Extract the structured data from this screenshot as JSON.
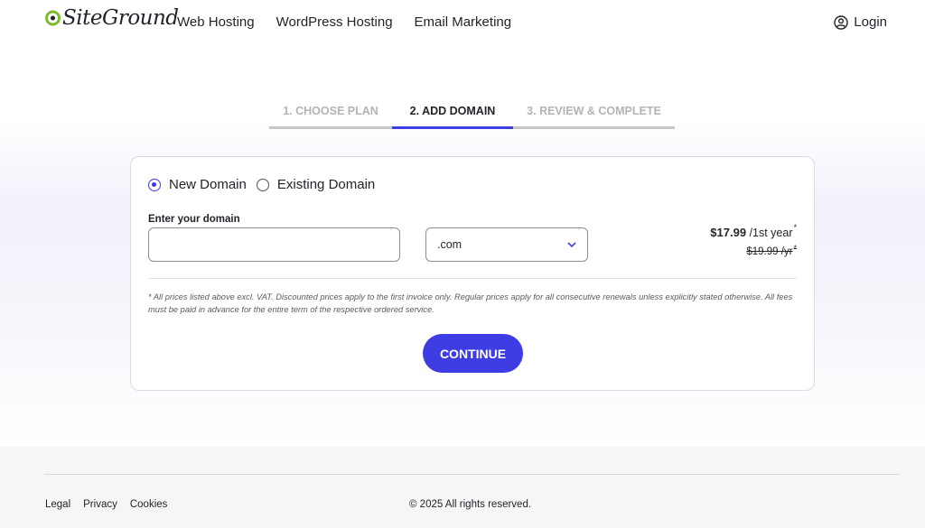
{
  "header": {
    "logo_text": "SiteGround",
    "nav": [
      "Web Hosting",
      "WordPress Hosting",
      "Email Marketing"
    ],
    "login_label": "Login"
  },
  "steps": [
    "1. CHOOSE PLAN",
    "2. ADD DOMAIN",
    "3. REVIEW & COMPLETE"
  ],
  "form": {
    "radio_new": "New Domain",
    "radio_existing": "Existing Domain",
    "selected_option": "New Domain",
    "domain_label": "Enter your domain",
    "domain_value": "",
    "tld_selected": ".com",
    "price_now": "$17.99",
    "price_period": "/1st year",
    "price_old": "$19.99 /yr",
    "price_marker": "*",
    "disclaimer": "* All prices listed above excl. VAT. Discounted prices apply to the first invoice only. Regular prices apply for all consecutive renewals unless explicitly stated otherwise. All fees must be paid in advance for the entire term of the respective ordered service.",
    "continue_label": "CONTINUE"
  },
  "footer": {
    "links": [
      "Legal",
      "Privacy",
      "Cookies"
    ],
    "copyright": "© 2025 All rights reserved."
  },
  "colors": {
    "accent": "#3e3ce3",
    "logo_green": "#7cbc2d",
    "text": "#24232b"
  }
}
